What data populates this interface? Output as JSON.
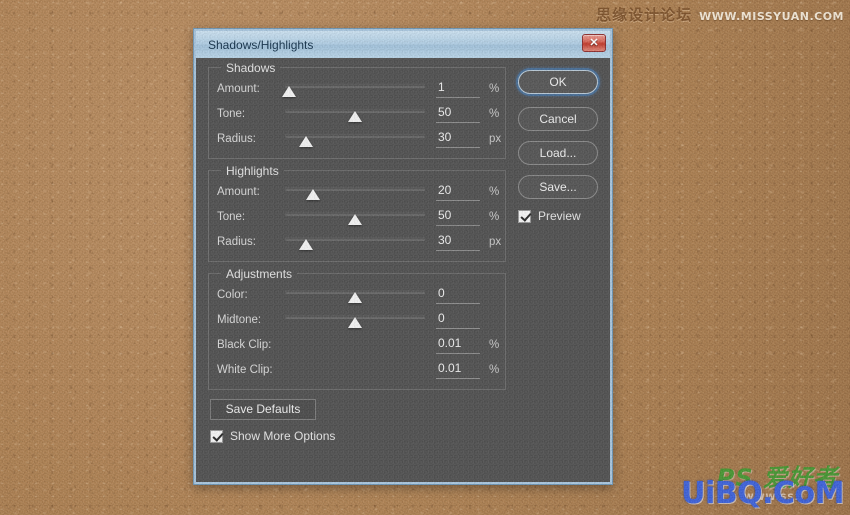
{
  "watermarks": {
    "top_cn": "思缘设计论坛",
    "top_url": "WWW.MISSYUAN.COM",
    "bottom_ps": "PS 爱好者",
    "bottom_brand": "UiBQ.CoM",
    "bottom_sub": "WWW.SS2"
  },
  "dialog": {
    "title": "Shadows/Highlights",
    "close_glyph": "✕",
    "close_label": "Close"
  },
  "groups": [
    {
      "legend": "Shadows",
      "rows": [
        {
          "label": "Amount:",
          "value": "1",
          "unit": "%",
          "slider_pct": 3,
          "has_slider": true
        },
        {
          "label": "Tone:",
          "value": "50",
          "unit": "%",
          "slider_pct": 50,
          "has_slider": true
        },
        {
          "label": "Radius:",
          "value": "30",
          "unit": "px",
          "slider_pct": 15,
          "has_slider": true
        }
      ]
    },
    {
      "legend": "Highlights",
      "rows": [
        {
          "label": "Amount:",
          "value": "20",
          "unit": "%",
          "slider_pct": 20,
          "has_slider": true
        },
        {
          "label": "Tone:",
          "value": "50",
          "unit": "%",
          "slider_pct": 50,
          "has_slider": true
        },
        {
          "label": "Radius:",
          "value": "30",
          "unit": "px",
          "slider_pct": 15,
          "has_slider": true
        }
      ]
    },
    {
      "legend": "Adjustments",
      "rows": [
        {
          "label": "Color:",
          "value": "0",
          "unit": "",
          "slider_pct": 50,
          "has_slider": true
        },
        {
          "label": "Midtone:",
          "value": "0",
          "unit": "",
          "slider_pct": 50,
          "has_slider": true
        },
        {
          "label": "Black Clip:",
          "value": "0.01",
          "unit": "%",
          "slider_pct": 0,
          "has_slider": false
        },
        {
          "label": "White Clip:",
          "value": "0.01",
          "unit": "%",
          "slider_pct": 0,
          "has_slider": false
        }
      ]
    }
  ],
  "buttons": {
    "ok": "OK",
    "cancel": "Cancel",
    "load": "Load...",
    "save": "Save...",
    "save_defaults": "Save Defaults"
  },
  "checkboxes": {
    "preview": {
      "label": "Preview",
      "checked": true
    },
    "show_more": {
      "label": "Show More Options",
      "checked": true
    }
  },
  "colors": {
    "panel": "#535353",
    "titlebar": "#b2cee3",
    "frame": "#a9c6dd",
    "close_red": "#c0392b",
    "focus_blue": "#4a6f96",
    "desktop": "#b08355"
  }
}
